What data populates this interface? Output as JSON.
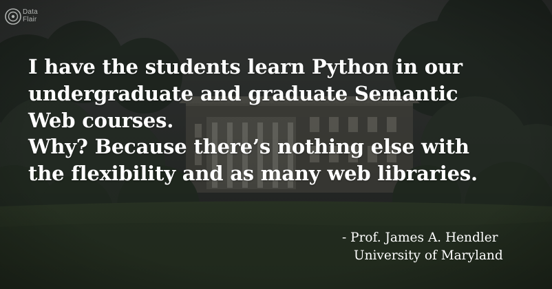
{
  "logo": {
    "line1": "Data",
    "line2": "Flair",
    "icon": "dataflair-logo-icon"
  },
  "quote": {
    "lines": [
      "I have the students learn Python in our",
      "undergraduate and graduate Semantic",
      "Web courses.",
      "Why? Because there’s nothing else with",
      "the flexibility and as many web libraries."
    ]
  },
  "attribution": {
    "name": "- Prof. James A. Hendler",
    "organization": "University of Maryland"
  },
  "colors": {
    "text": "#ffffff",
    "overlay": "#1f2421",
    "foliage": "#2c3a2c",
    "lawn": "#3c4c33"
  }
}
